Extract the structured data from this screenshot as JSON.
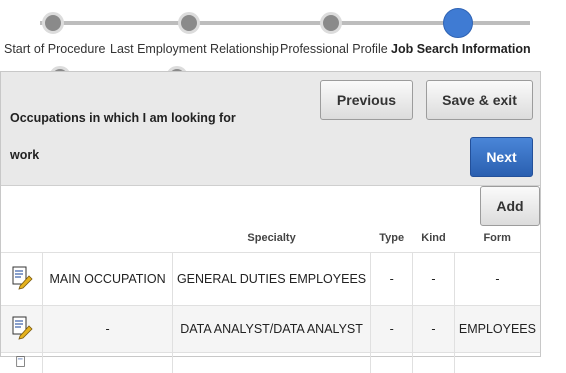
{
  "steps": [
    {
      "label": "Start of Procedure",
      "state": "done"
    },
    {
      "label": "Last Employment Relationship",
      "state": "done"
    },
    {
      "label": "Professional Profile",
      "state": "done"
    },
    {
      "label": "Job Search Information",
      "state": "active"
    }
  ],
  "section": {
    "title": "Occupations in which I am looking for work"
  },
  "buttons": {
    "previous": "Previous",
    "save_exit": "Save & exit",
    "next": "Next",
    "add": "Add"
  },
  "table": {
    "headers": [
      "",
      "",
      "Specialty",
      "Type",
      "Kind",
      "Form"
    ],
    "rows": [
      {
        "col1": "MAIN OCCUPATION",
        "specialty": "GENERAL DUTIES EMPLOYEES",
        "type": "-",
        "kind": "-",
        "form": "-"
      },
      {
        "col1": "-",
        "specialty": "DATA ANALYST/DATA ANALYST",
        "type": "-",
        "kind": "-",
        "form": "EMPLOYEES"
      }
    ]
  },
  "icons": {
    "edit": "edit-document-icon"
  }
}
